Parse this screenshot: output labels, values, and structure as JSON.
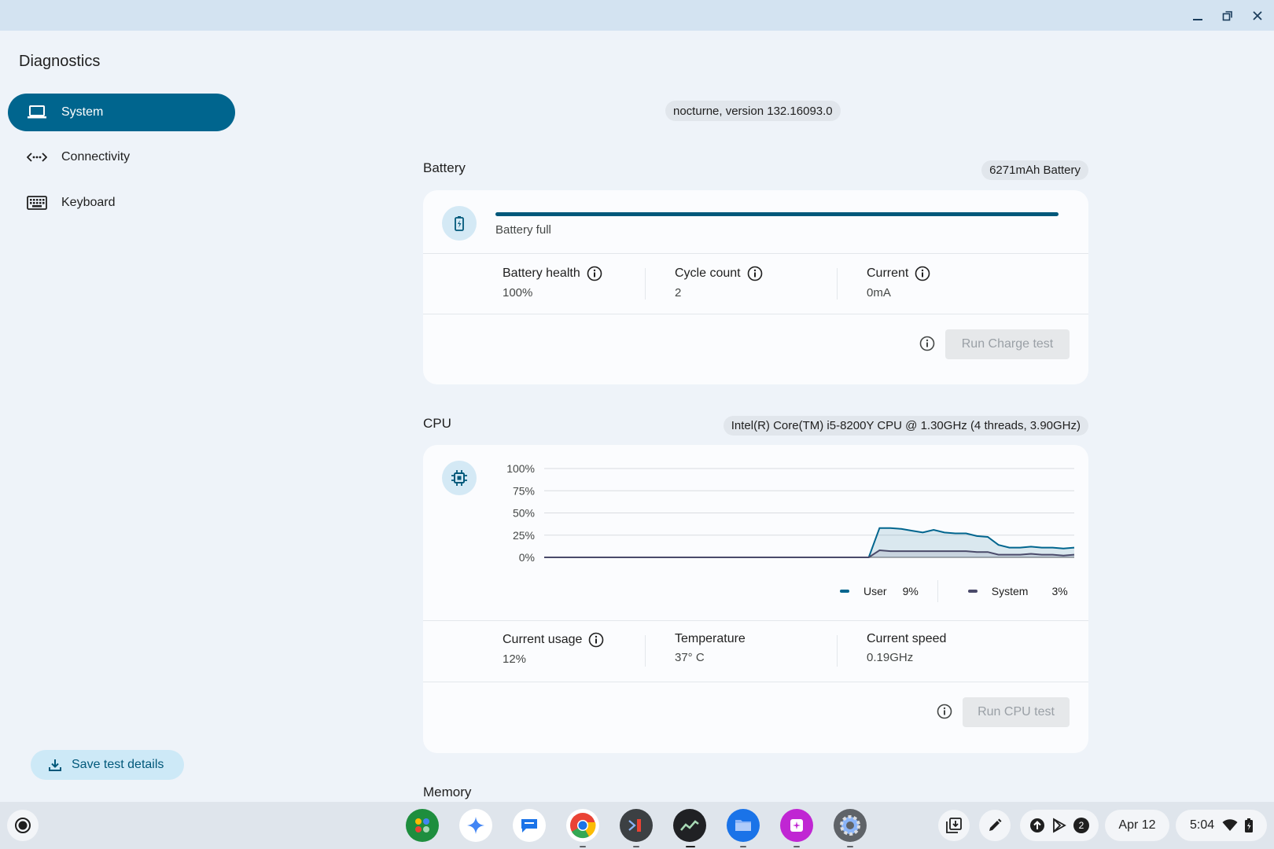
{
  "window": {
    "controls": {
      "minimize_icon": "minimize-icon",
      "restore_icon": "restore-icon",
      "close_icon": "close-icon"
    }
  },
  "app": {
    "title": "Diagnostics"
  },
  "sidebar": {
    "items": [
      {
        "label": "System",
        "icon": "laptop-icon",
        "active": true
      },
      {
        "label": "Connectivity",
        "icon": "connectivity-icon",
        "active": false
      },
      {
        "label": "Keyboard",
        "icon": "keyboard-icon",
        "active": false
      }
    ],
    "save_label": "Save test details"
  },
  "main": {
    "version": "nocturne, version 132.16093.0",
    "battery": {
      "title": "Battery",
      "chip": "6271mAh Battery",
      "status": "Battery full",
      "charge_level": 1.0,
      "stats": [
        {
          "label": "Battery health",
          "value": "100%"
        },
        {
          "label": "Cycle count",
          "value": "2"
        },
        {
          "label": "Current",
          "value": "0mA"
        }
      ],
      "run_label": "Run Charge test"
    },
    "cpu": {
      "title": "CPU",
      "chip": "Intel(R) Core(TM) i5-8200Y CPU @ 1.30GHz (4 threads, 3.90GHz)",
      "legend": {
        "user_label": "User",
        "user_value": "9%",
        "system_label": "System",
        "system_value": "3%"
      },
      "stats": [
        {
          "label": "Current usage",
          "value": "12%"
        },
        {
          "label": "Temperature",
          "value": "37° C"
        },
        {
          "label": "Current speed",
          "value": "0.19GHz"
        }
      ],
      "run_label": "Run CPU test"
    },
    "memory": {
      "title": "Memory"
    }
  },
  "chart_data": {
    "type": "area",
    "y_ticks": [
      "100%",
      "75%",
      "50%",
      "25%",
      "0%"
    ],
    "ylim": [
      0,
      100
    ],
    "x": [
      0,
      1,
      2,
      3,
      4,
      5,
      6,
      7,
      8,
      9,
      10,
      11,
      12,
      13,
      14,
      15,
      16,
      17,
      18,
      19,
      20,
      21,
      22,
      23,
      24,
      25,
      26,
      27,
      28,
      29,
      30,
      31,
      32,
      33,
      34,
      35,
      36,
      37,
      38,
      39,
      40,
      41,
      42,
      43,
      44,
      45,
      46,
      47,
      48,
      49
    ],
    "series": [
      {
        "name": "User",
        "color": "#00658e",
        "values": [
          0,
          0,
          0,
          0,
          0,
          0,
          0,
          0,
          0,
          0,
          0,
          0,
          0,
          0,
          0,
          0,
          0,
          0,
          0,
          0,
          0,
          0,
          0,
          0,
          0,
          0,
          0,
          0,
          0,
          0,
          0,
          33,
          33,
          32,
          30,
          28,
          31,
          28,
          27,
          27,
          24,
          23,
          14,
          11,
          11,
          12,
          11,
          11,
          10,
          11
        ]
      },
      {
        "name": "System",
        "color": "#4a4a6a",
        "values": [
          0,
          0,
          0,
          0,
          0,
          0,
          0,
          0,
          0,
          0,
          0,
          0,
          0,
          0,
          0,
          0,
          0,
          0,
          0,
          0,
          0,
          0,
          0,
          0,
          0,
          0,
          0,
          0,
          0,
          0,
          0,
          8,
          7,
          7,
          7,
          7,
          7,
          7,
          7,
          7,
          6,
          6,
          3,
          3,
          3,
          4,
          3,
          3,
          2,
          3
        ]
      }
    ]
  },
  "shelf": {
    "apps": [
      {
        "name": "app-launcher-grid-icon",
        "bg": "#1e8e3e"
      },
      {
        "name": "gemini-icon",
        "bg": "#ffffff"
      },
      {
        "name": "messages-icon",
        "bg": "#ffffff"
      },
      {
        "name": "chrome-icon",
        "bg": "#ffffff"
      },
      {
        "name": "terminal-icon",
        "bg": "#3c4043"
      },
      {
        "name": "diagnostics-icon",
        "bg": "#202124"
      },
      {
        "name": "files-icon",
        "bg": "#1a73e8"
      },
      {
        "name": "screenshot-app-icon",
        "bg": "#c026d3"
      },
      {
        "name": "settings-icon",
        "bg": "#5f6368"
      }
    ],
    "notification_count": "2",
    "date": "Apr 12",
    "time": "5:04"
  }
}
